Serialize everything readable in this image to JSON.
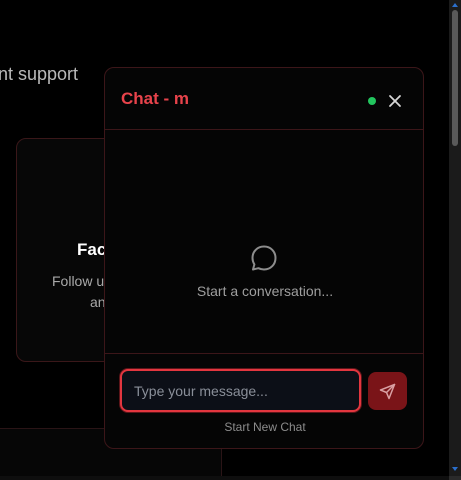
{
  "background": {
    "heading_fragment": "nt support",
    "card": {
      "title_fragment": "Fac",
      "text_line1_fragment": "Follow u",
      "text_line2_fragment": "an"
    }
  },
  "chat": {
    "title": "Chat - m",
    "status": "online",
    "status_color": "#22c55e",
    "accent_color": "#e8434b",
    "close_icon": "close-icon",
    "empty_icon": "chat-bubble-icon",
    "empty_state_text": "Start a conversation...",
    "input": {
      "value": "",
      "placeholder": "Type your message..."
    },
    "send_icon": "send-icon",
    "new_chat_label": "Start New Chat"
  }
}
